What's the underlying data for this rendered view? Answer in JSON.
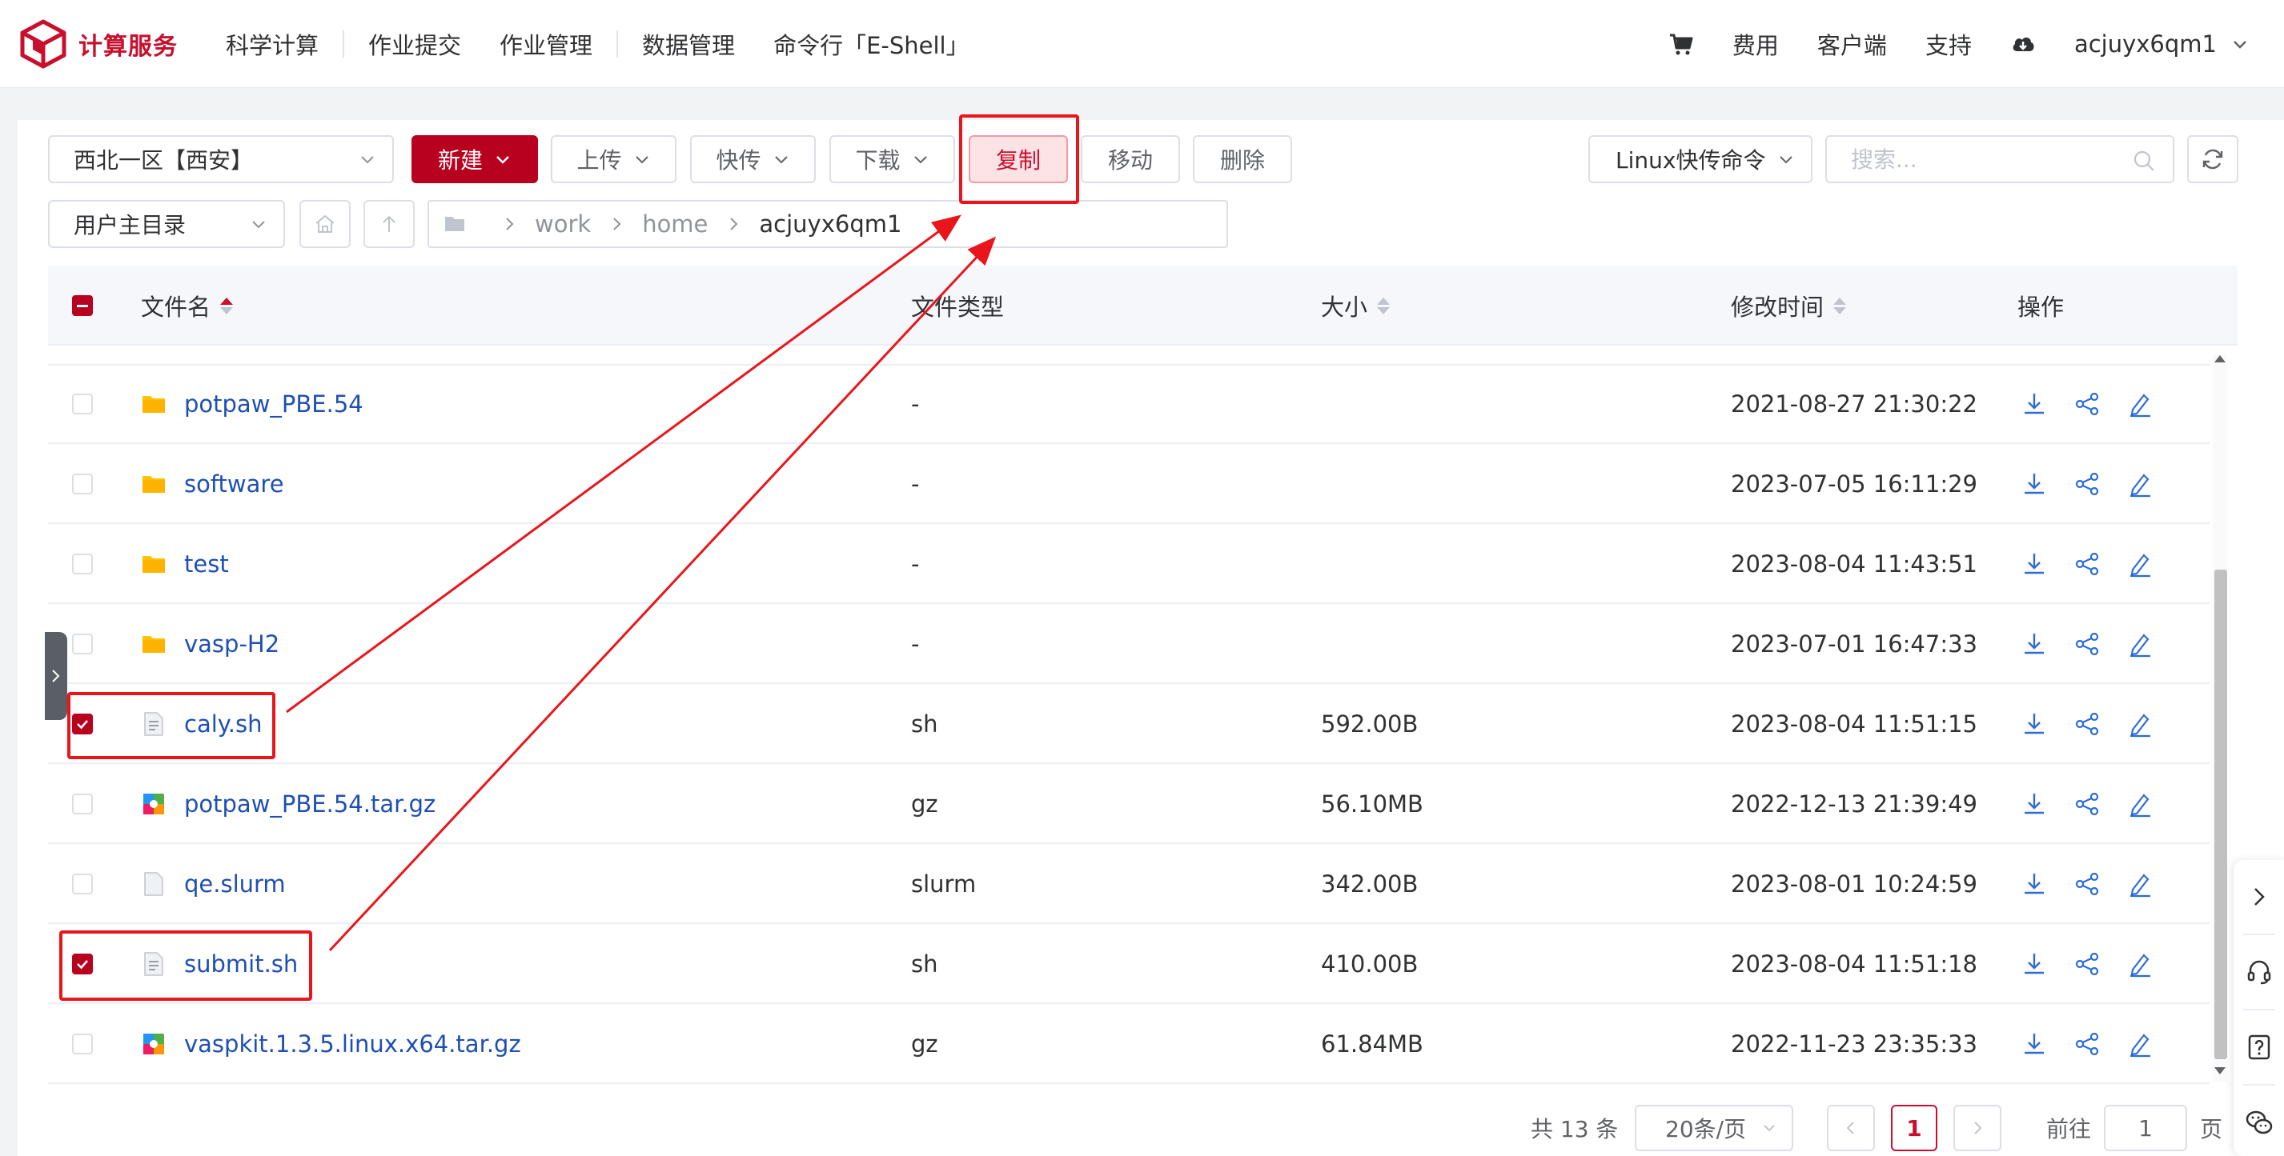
{
  "header": {
    "brand": "计算服务",
    "nav": [
      "科学计算",
      "作业提交",
      "作业管理",
      "数据管理",
      "命令行「E-Shell」"
    ],
    "right": {
      "cart_icon": "cart-icon",
      "fee": "费用",
      "client": "客户端",
      "support": "支持",
      "cloud_icon": "cloud-download-icon",
      "username": "acjuyx6qm1"
    }
  },
  "toolbar": {
    "region": "西北一区【西安】",
    "new_label": "新建",
    "upload_label": "上传",
    "fast_label": "快传",
    "download_label": "下载",
    "copy_label": "复制",
    "move_label": "移动",
    "delete_label": "删除",
    "linux_cmd": "Linux快传命令",
    "search_placeholder": "搜索...",
    "home_dir": "用户主目录"
  },
  "breadcrumb": [
    "work",
    "home",
    "acjuyx6qm1"
  ],
  "table": {
    "columns": {
      "name": "文件名",
      "type": "文件类型",
      "size": "大小",
      "mtime": "修改时间",
      "ops": "操作"
    },
    "rows": [
      {
        "name": "potpaw_PBE.54",
        "kind": "folder",
        "type": "-",
        "size": "",
        "mtime": "2021-08-27 21:30:22",
        "checked": false
      },
      {
        "name": "software",
        "kind": "folder",
        "type": "-",
        "size": "",
        "mtime": "2023-07-05 16:11:29",
        "checked": false
      },
      {
        "name": "test",
        "kind": "folder",
        "type": "-",
        "size": "",
        "mtime": "2023-08-04 11:43:51",
        "checked": false
      },
      {
        "name": "vasp-H2",
        "kind": "folder",
        "type": "-",
        "size": "",
        "mtime": "2023-07-01 16:47:33",
        "checked": false
      },
      {
        "name": "caly.sh",
        "kind": "text",
        "type": "sh",
        "size": "592.00B",
        "mtime": "2023-08-04 11:51:15",
        "checked": true
      },
      {
        "name": "potpaw_PBE.54.tar.gz",
        "kind": "archive",
        "type": "gz",
        "size": "56.10MB",
        "mtime": "2022-12-13 21:39:49",
        "checked": false
      },
      {
        "name": "qe.slurm",
        "kind": "blank",
        "type": "slurm",
        "size": "342.00B",
        "mtime": "2023-08-01 10:24:59",
        "checked": false
      },
      {
        "name": "submit.sh",
        "kind": "text",
        "type": "sh",
        "size": "410.00B",
        "mtime": "2023-08-04 11:51:18",
        "checked": true
      },
      {
        "name": "vaspkit.1.3.5.linux.x64.tar.gz",
        "kind": "archive",
        "type": "gz",
        "size": "61.84MB",
        "mtime": "2022-11-23 23:35:33",
        "checked": false
      }
    ]
  },
  "pagination": {
    "total": "共 13 条",
    "page_size": "20条/页",
    "current": "1",
    "goto_prefix": "前往",
    "goto_value": "1",
    "goto_suffix": "页"
  },
  "colors": {
    "brand": "#c8102e",
    "primary_button": "#b8001f",
    "link": "#1f4fb3",
    "annotation": "#e8161b",
    "folder": "#ffc107"
  }
}
